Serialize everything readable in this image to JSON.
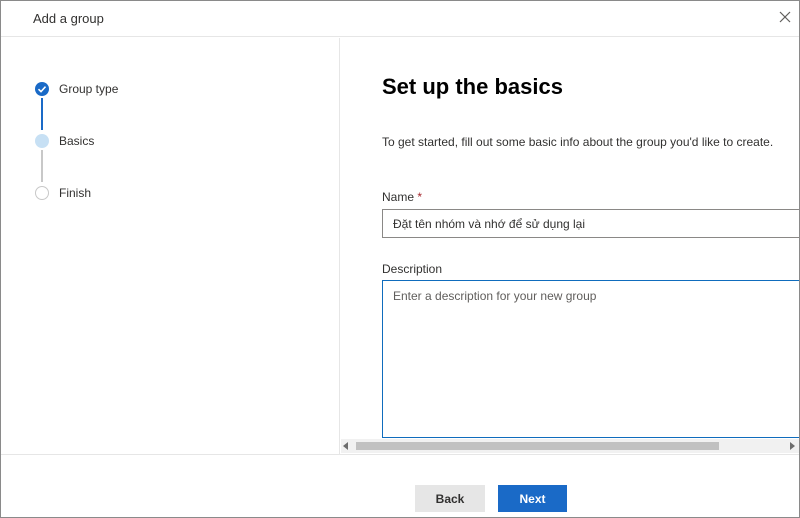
{
  "dialog": {
    "title": "Add a group",
    "close_icon": "close-icon"
  },
  "steps": [
    {
      "label": "Group type",
      "state": "done"
    },
    {
      "label": "Basics",
      "state": "current"
    },
    {
      "label": "Finish",
      "state": "todo"
    }
  ],
  "content": {
    "heading": "Set up the basics",
    "intro": "To get started, fill out some basic info about the group you'd like to create.",
    "name_label": "Name",
    "name_required_marker": "*",
    "name_value": "Đặt tên nhóm và nhớ để sử dụng lại",
    "description_label": "Description",
    "description_placeholder": "Enter a description for your new group"
  },
  "footer": {
    "back_label": "Back",
    "next_label": "Next"
  },
  "colors": {
    "accent": "#1a6ac7",
    "current_step": "#c7e0f4",
    "required": "#a4262c"
  }
}
